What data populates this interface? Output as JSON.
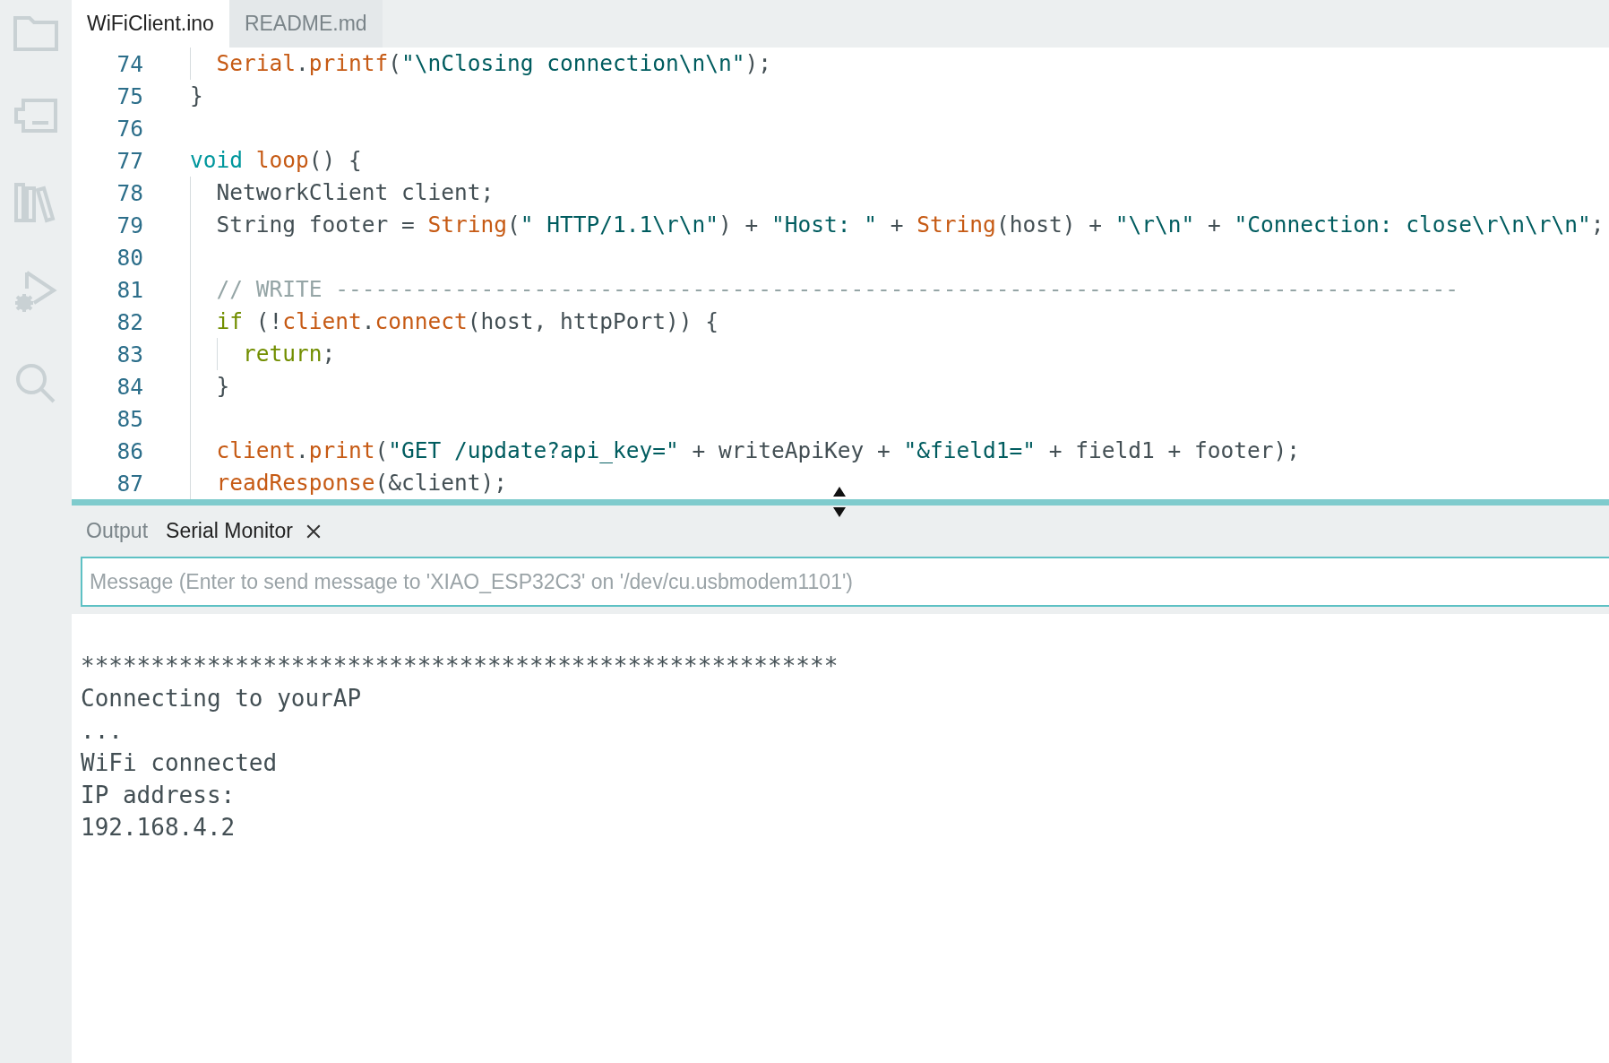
{
  "editor_tabs": [
    {
      "label": "WiFiClient.ino",
      "selected": true
    },
    {
      "label": "README.md",
      "selected": false
    }
  ],
  "code_lines": [
    {
      "number": "74",
      "tokens": [
        {
          "kind": "func",
          "text": "  Serial"
        },
        {
          "kind": "plain",
          "text": "."
        },
        {
          "kind": "func",
          "text": "printf"
        },
        {
          "kind": "plain",
          "text": "("
        },
        {
          "kind": "string",
          "text": "\"\\nClosing connection\\n\\n\""
        },
        {
          "kind": "plain",
          "text": ");"
        }
      ]
    },
    {
      "number": "75",
      "tokens": [
        {
          "kind": "plain",
          "text": "}"
        }
      ]
    },
    {
      "number": "76"
    },
    {
      "number": "77",
      "tokens": [
        {
          "kind": "type",
          "text": "void "
        },
        {
          "kind": "func",
          "text": "loop"
        },
        {
          "kind": "plain",
          "text": "() {"
        }
      ]
    },
    {
      "number": "78",
      "tokens": [
        {
          "kind": "plain",
          "text": "  NetworkClient client;"
        }
      ]
    },
    {
      "number": "79",
      "tokens": [
        {
          "kind": "plain",
          "text": "  String footer = "
        },
        {
          "kind": "func",
          "text": "String"
        },
        {
          "kind": "plain",
          "text": "("
        },
        {
          "kind": "string",
          "text": "\" HTTP/1.1\\r\\n\""
        },
        {
          "kind": "plain",
          "text": ") + "
        },
        {
          "kind": "string",
          "text": "\"Host: \""
        },
        {
          "kind": "plain",
          "text": " + "
        },
        {
          "kind": "func",
          "text": "String"
        },
        {
          "kind": "plain",
          "text": "(host) + "
        },
        {
          "kind": "string",
          "text": "\"\\r\\n\""
        },
        {
          "kind": "plain",
          "text": " + "
        },
        {
          "kind": "string",
          "text": "\"Connection: close\\r\\n\\r\\n\""
        },
        {
          "kind": "plain",
          "text": ";"
        }
      ]
    },
    {
      "number": "80"
    },
    {
      "number": "81",
      "tokens": [
        {
          "kind": "comment",
          "text": "  // WRITE -------------------------------------------------------------------------------------"
        }
      ]
    },
    {
      "number": "82",
      "tokens": [
        {
          "kind": "control",
          "text": "  if"
        },
        {
          "kind": "plain",
          "text": " (!"
        },
        {
          "kind": "func",
          "text": "client"
        },
        {
          "kind": "plain",
          "text": "."
        },
        {
          "kind": "func",
          "text": "connect"
        },
        {
          "kind": "plain",
          "text": "(host, httpPort)) {"
        }
      ]
    },
    {
      "number": "83",
      "tokens": [
        {
          "kind": "control",
          "text": "    return"
        },
        {
          "kind": "plain",
          "text": ";"
        }
      ]
    },
    {
      "number": "84",
      "tokens": [
        {
          "kind": "plain",
          "text": "  }"
        }
      ]
    },
    {
      "number": "85"
    },
    {
      "number": "86",
      "tokens": [
        {
          "kind": "func",
          "text": "  client"
        },
        {
          "kind": "plain",
          "text": "."
        },
        {
          "kind": "func",
          "text": "print"
        },
        {
          "kind": "plain",
          "text": "("
        },
        {
          "kind": "string",
          "text": "\"GET /update?api_key=\""
        },
        {
          "kind": "plain",
          "text": " + writeApiKey + "
        },
        {
          "kind": "string",
          "text": "\"&field1=\""
        },
        {
          "kind": "plain",
          "text": " + field1 + footer);"
        }
      ]
    },
    {
      "number": "87",
      "tokens": [
        {
          "kind": "func",
          "text": "  readResponse"
        },
        {
          "kind": "plain",
          "text": "(&client);"
        }
      ]
    }
  ],
  "panel_tabs": [
    {
      "label": "Output",
      "selected": false
    },
    {
      "label": "Serial Monitor",
      "selected": true
    }
  ],
  "message_field": {
    "placeholder": "Message (Enter to send message to 'XIAO_ESP32C3' on '/dev/cu.usbmodem1101')"
  },
  "serial_output": [
    "******************************************************",
    "Connecting to yourAP",
    "...",
    "WiFi connected",
    "IP address:",
    "192.168.4.2"
  ]
}
